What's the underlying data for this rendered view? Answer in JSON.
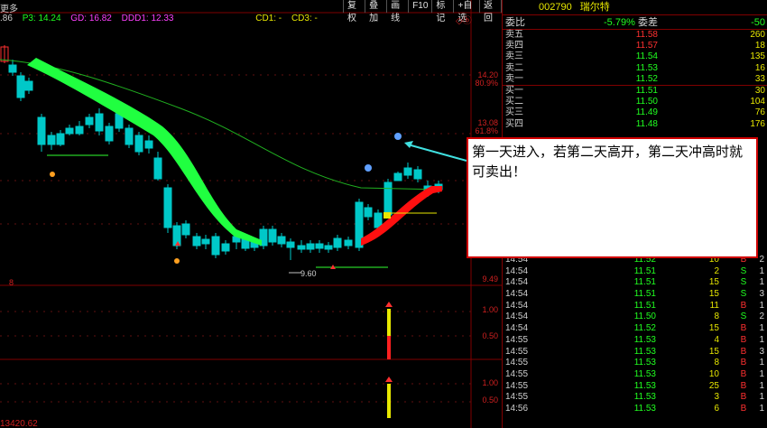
{
  "toolbar": {
    "top_left": "更多",
    "buttons": [
      "复权",
      "叠加",
      "画线",
      "F10",
      "标记",
      "+自选",
      "返回"
    ],
    "cursor_marker": "◇ⓑ"
  },
  "indicators": {
    "prefix": ".86",
    "p3": "P3: 14.24",
    "gd": "GD: 16.82",
    "ddd1": "DDD1: 12.33",
    "cd1": "CD1: -",
    "cd3": "CD3: -"
  },
  "axis": {
    "price_labels": [
      "14.20",
      "80.9%",
      "13.08",
      "61.8%",
      "9.49"
    ],
    "mid_labels": [
      "1.00",
      "0.50"
    ],
    "low_labels": [
      "1.00",
      "0.50"
    ],
    "low_point": "9.60",
    "bottom_left": "13420.62",
    "separator_mark": "8"
  },
  "callout": {
    "text": "第一天进入，若第二天高开，第二天冲高时就可卖出！"
  },
  "quote": {
    "code": "002790",
    "name": "瑞尔特",
    "ratio_label": "委比",
    "ratio_value": "-5.79%",
    "diff_label": "委差",
    "diff_value": "-50",
    "asks": [
      {
        "label": "卖五",
        "price": "11.58",
        "vol": "260"
      },
      {
        "label": "卖四",
        "price": "11.57",
        "vol": "18"
      },
      {
        "label": "卖三",
        "price": "11.54",
        "vol": "135"
      },
      {
        "label": "卖二",
        "price": "11.53",
        "vol": "16"
      },
      {
        "label": "卖一",
        "price": "11.52",
        "vol": "33"
      }
    ],
    "bids": [
      {
        "label": "买一",
        "price": "11.51",
        "vol": "30"
      },
      {
        "label": "买二",
        "price": "11.50",
        "vol": "104"
      },
      {
        "label": "买三",
        "price": "11.49",
        "vol": "76"
      },
      {
        "label": "买四",
        "price": "11.48",
        "vol": "176"
      }
    ],
    "ticks": [
      {
        "time": "14:54",
        "price": "11.52",
        "vol": "10",
        "dir": "B",
        "num": "2"
      },
      {
        "time": "14:54",
        "price": "11.51",
        "vol": "2",
        "dir": "S",
        "num": "1"
      },
      {
        "time": "14:54",
        "price": "11.51",
        "vol": "15",
        "dir": "S",
        "num": "1"
      },
      {
        "time": "14:54",
        "price": "11.51",
        "vol": "15",
        "dir": "S",
        "num": "3"
      },
      {
        "time": "14:54",
        "price": "11.51",
        "vol": "11",
        "dir": "B",
        "num": "1"
      },
      {
        "time": "14:54",
        "price": "11.50",
        "vol": "8",
        "dir": "S",
        "num": "2"
      },
      {
        "time": "14:54",
        "price": "11.52",
        "vol": "15",
        "dir": "B",
        "num": "1"
      },
      {
        "time": "14:55",
        "price": "11.53",
        "vol": "4",
        "dir": "B",
        "num": "1"
      },
      {
        "time": "14:55",
        "price": "11.53",
        "vol": "15",
        "dir": "B",
        "num": "3"
      },
      {
        "time": "14:55",
        "price": "11.53",
        "vol": "8",
        "dir": "B",
        "num": "1"
      },
      {
        "time": "14:55",
        "price": "11.53",
        "vol": "10",
        "dir": "B",
        "num": "1"
      },
      {
        "time": "14:55",
        "price": "11.53",
        "vol": "25",
        "dir": "B",
        "num": "1"
      },
      {
        "time": "14:55",
        "price": "11.53",
        "vol": "3",
        "dir": "B",
        "num": "1"
      },
      {
        "time": "14:56",
        "price": "11.53",
        "vol": "6",
        "dir": "B",
        "num": "1"
      }
    ]
  },
  "colors": {
    "up": "#ff3030",
    "down": "#00c8c8",
    "band_up": "#ff1010",
    "band_down": "#20ff40",
    "ma": "#20b020",
    "panel_border": "#800000",
    "accent_yellow": "#e8e800"
  }
}
